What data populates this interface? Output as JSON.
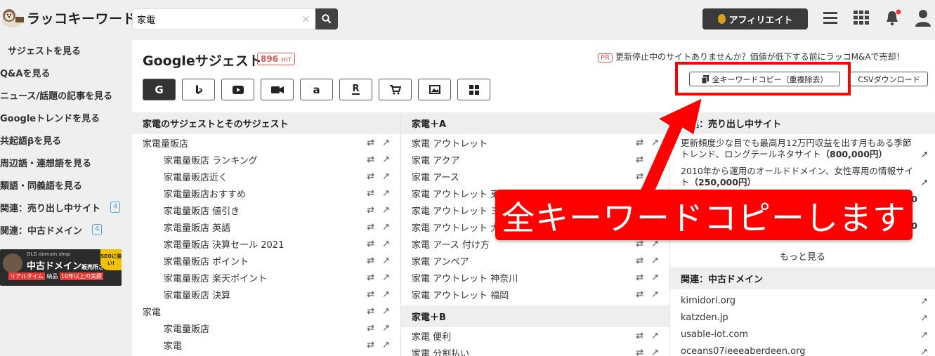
{
  "app": {
    "logo_text": "ラッコキーワード"
  },
  "search": {
    "value": "家電",
    "clear_glyph": "×"
  },
  "header": {
    "affiliate_label": "アフィリエイト"
  },
  "sidebar": {
    "items": [
      {
        "label": "サジェストを見る"
      },
      {
        "label": "Q&Aを見る"
      },
      {
        "label": "ニュース/話題の記事を見る"
      },
      {
        "label": "Googleトレンドを見る"
      },
      {
        "label": "共起語βを見る"
      },
      {
        "label": "周辺語・連想語を見る"
      },
      {
        "label": "類語・同義語を見る"
      },
      {
        "label": "関連：売り出し中サイト",
        "count": "4"
      },
      {
        "label": "関連：中古ドメイン",
        "count": "4"
      }
    ],
    "banner": {
      "small": "OLD domain shop",
      "title": "中古ドメイン",
      "sub": "販売所さん",
      "tag1": "リアルタイム",
      "tag1b": "納品",
      "tag2": "10年以上の実績",
      "seal": "SEOに強い!"
    }
  },
  "main": {
    "title": "Googleサジェスト",
    "hit_count": "896",
    "hit_unit": "HIT",
    "pr_badge": "PR",
    "pr_text": "更新停止中のサイトありませんか？価値が低下する前にラッコM&Aで売却！",
    "copy_all_label": "全キーワードコピー（重複除去）",
    "csv_label": "CSVダウンロード",
    "engines": [
      "google",
      "bing",
      "youtube",
      "video",
      "amazon",
      "rakuten",
      "shopping",
      "image",
      "app"
    ],
    "engine_glyphs": {
      "google": "G",
      "amazon": "a",
      "rakuten": "R"
    }
  },
  "col1": {
    "header": "家電のサジェストとそのサジェスト",
    "rows": [
      {
        "text": "家電量販店",
        "level": 1
      },
      {
        "text": "家電量販店 ランキング",
        "level": 2
      },
      {
        "text": "家電量販店近く",
        "level": 2
      },
      {
        "text": "家電量販店おすすめ",
        "level": 2
      },
      {
        "text": "家電量販店 値引き",
        "level": 2
      },
      {
        "text": "家電量販店 英語",
        "level": 2
      },
      {
        "text": "家電量販店 決算セール 2021",
        "level": 2
      },
      {
        "text": "家電量販店 ポイント",
        "level": 2
      },
      {
        "text": "家電量販店 楽天ポイント",
        "level": 2
      },
      {
        "text": "家電量販店 決算",
        "level": 2
      },
      {
        "text": "家電",
        "level": 1
      },
      {
        "text": "家電量販店",
        "level": 2
      },
      {
        "text": "家電",
        "level": 2
      }
    ]
  },
  "col2": {
    "header_a": "家電＋A",
    "rows_a": [
      "家電 アウトレット",
      "家電 アクア",
      "家電 アース",
      "家電 アウトレット 東",
      "家電 アウトレット ヨ",
      "家電 アウトレット 大",
      "家電 アース 付け方",
      "家電 アンペア",
      "家電 アウトレット 神奈川",
      "家電 アウトレット 福岡"
    ],
    "header_b": "家電＋B",
    "rows_b": [
      "家電 便利",
      "家電 分割払い"
    ]
  },
  "col3": {
    "header": "関連：売り出し中サイト",
    "sites": [
      {
        "text": "更新頻度少な目でも最高月12万円収益を出す月もある季節トレンド、ロングテールネタサイト",
        "price": "（800,000円）"
      },
      {
        "text": "2010年から運用のオールドドメイン、女性専用の情報サイト",
        "price": "（250,000円）"
      },
      {
        "text": "",
        "price": "000"
      },
      {
        "text": "",
        "price": "000"
      }
    ],
    "more_label": "もっと見る",
    "domain_header": "関連：中古ドメイン",
    "domains": [
      "kimidori.org",
      "katzden.jp",
      "usable-iot.com",
      "oceans07ieeeaberdeen.org"
    ]
  },
  "annotation": {
    "callout": "全キーワードコピーします"
  },
  "colors": {
    "accent_red": "#ff0000",
    "dark": "#333333",
    "badge_blue": "#4aa3df"
  }
}
